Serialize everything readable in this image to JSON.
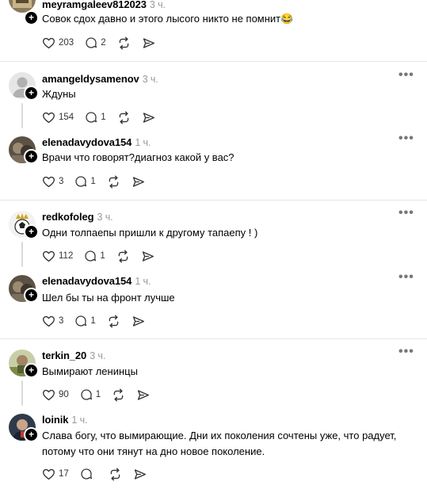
{
  "posts": [
    {
      "username": "meyramgaleev812023",
      "time": "3 ч.",
      "text": "Совок сдох давно и этого лысого никто не помнит😂",
      "likes": "203",
      "replies": "2"
    },
    {
      "username": "amangeldysamenov",
      "time": "3 ч.",
      "text": "Ждуны",
      "likes": "154",
      "replies": "1"
    },
    {
      "username": "elenadavydova154",
      "time": "1 ч.",
      "text": "Врачи что говорят?диагноз какой у вас?",
      "likes": "3",
      "replies": "1"
    },
    {
      "username": "redkofoleg",
      "time": "3 ч.",
      "text": "Одни толпаепы пришли к другому тапаепу ! )",
      "likes": "112",
      "replies": "1"
    },
    {
      "username": "elenadavydova154",
      "time": "1 ч.",
      "text": "Шел бы ты на фронт лучше",
      "likes": "3",
      "replies": "1"
    },
    {
      "username": "terkin_20",
      "time": "3 ч.",
      "text": "Вымирают ленинцы",
      "likes": "90",
      "replies": "1"
    },
    {
      "username": "loinik",
      "time": "1 ч.",
      "text_line1": "Слава богу, что вымирающие. Дни их поколения сочтены уже, что радует,",
      "text_line2": "потому что они тянут на дно новое поколение.",
      "likes": "17"
    }
  ],
  "more_glyph": "•••",
  "follow_glyph": "+",
  "icons": [
    "heart-icon",
    "comment-icon",
    "repost-icon",
    "share-icon",
    "more-options-icon",
    "follow-plus-icon"
  ]
}
